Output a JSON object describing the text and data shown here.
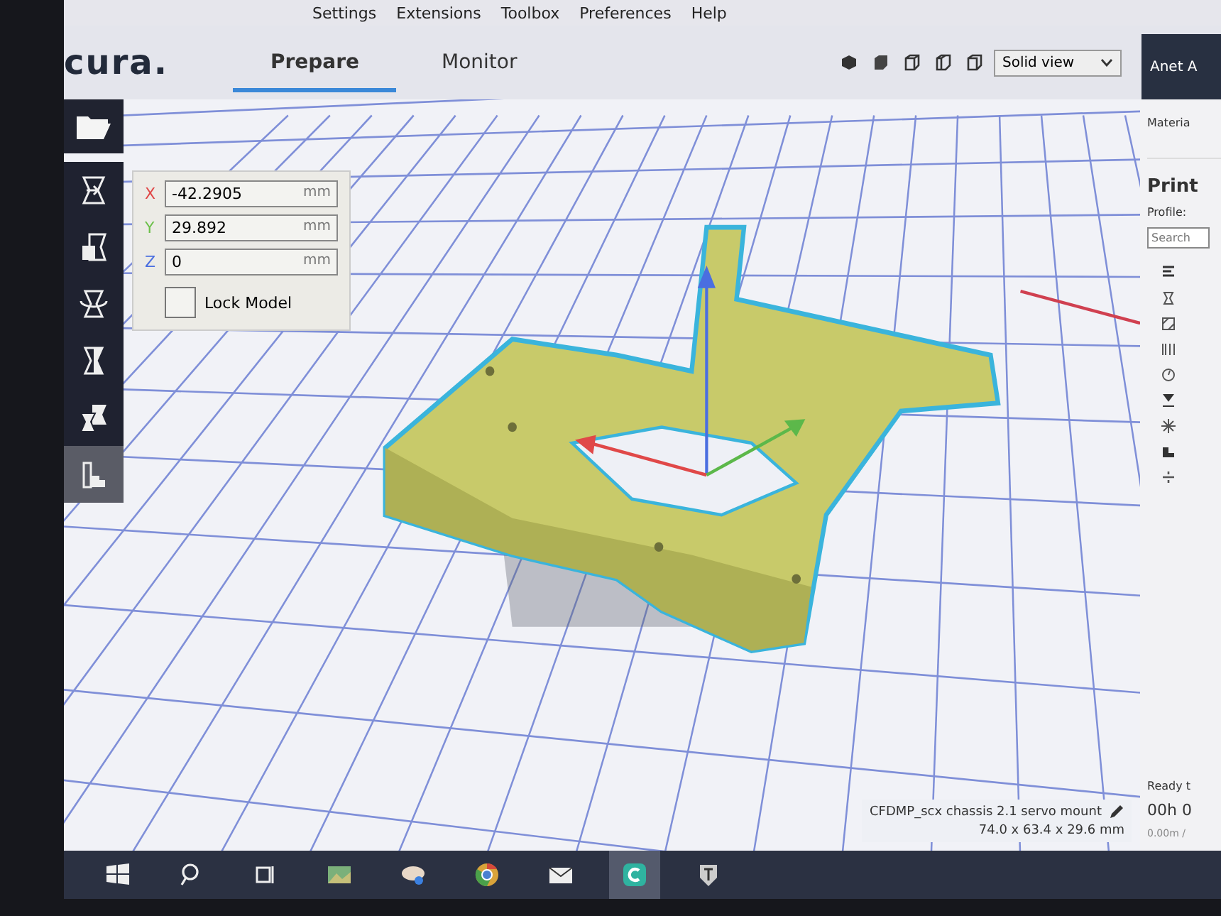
{
  "menu": [
    "Settings",
    "Extensions",
    "Toolbox",
    "Preferences",
    "Help"
  ],
  "logo": "cura.",
  "tabs": [
    {
      "label": "Prepare",
      "selected": true
    },
    {
      "label": "Monitor",
      "selected": false
    }
  ],
  "view_mode": "Solid view",
  "printer": "Anet A",
  "tools": [
    {
      "kind": "move",
      "selected": false
    },
    {
      "kind": "scale",
      "selected": false
    },
    {
      "kind": "rotate",
      "selected": false
    },
    {
      "kind": "mirror",
      "selected": false
    },
    {
      "kind": "multi",
      "selected": false
    },
    {
      "kind": "support",
      "selected": true
    }
  ],
  "move_panel": {
    "fields": [
      {
        "axis": "X",
        "value": "-42.2905",
        "unit": "mm",
        "color": "#e04848"
      },
      {
        "axis": "Y",
        "value": "29.892",
        "unit": "mm",
        "color": "#6cc04a"
      },
      {
        "axis": "Z",
        "value": "0",
        "unit": "mm",
        "color": "#4a6ee0"
      }
    ],
    "lock": {
      "label": "Lock Model",
      "checked": false
    }
  },
  "model": {
    "name": "CFDMP_scx chassis 2.1 servo mount",
    "dimensions": "74.0 x 63.4 x 29.6 mm"
  },
  "sidebar": {
    "material_label": "Materia",
    "title": "Print",
    "profile_label": "Profile:",
    "search_placeholder": "Search",
    "status": "Ready t",
    "time": "00h 0",
    "usage": "0.00m /"
  },
  "taskbar": [
    {
      "kind": "windows",
      "selected": false
    },
    {
      "kind": "search",
      "selected": false
    },
    {
      "kind": "taskview",
      "selected": false
    },
    {
      "kind": "photos",
      "selected": false
    },
    {
      "kind": "paint",
      "selected": false
    },
    {
      "kind": "browser",
      "selected": false
    },
    {
      "kind": "mail",
      "selected": false
    },
    {
      "kind": "cura",
      "selected": true
    },
    {
      "kind": "game",
      "selected": false
    }
  ]
}
